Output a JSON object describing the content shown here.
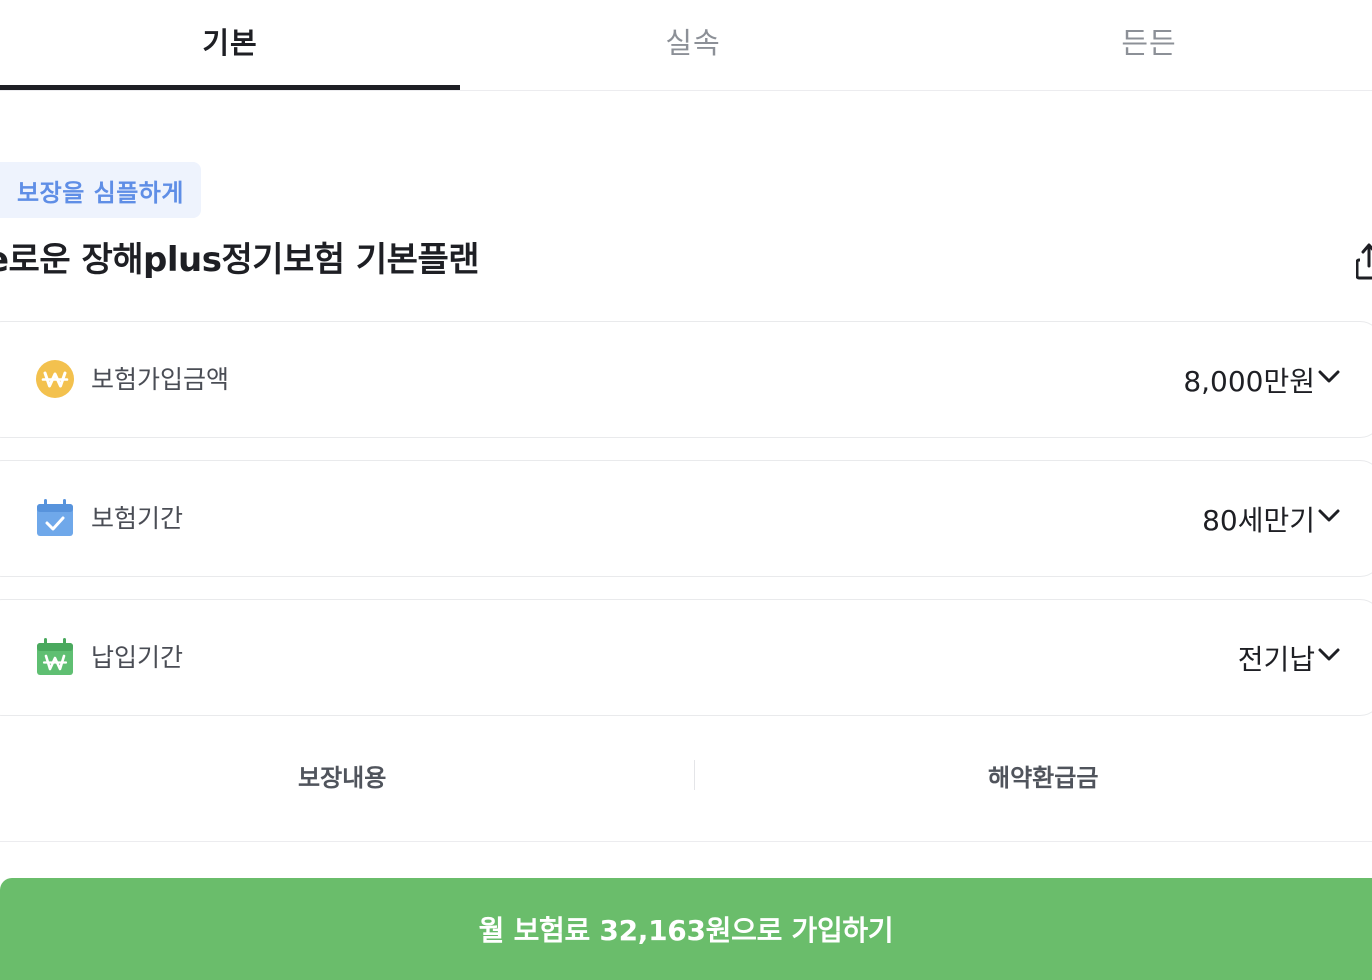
{
  "tabs": [
    {
      "label": "기본",
      "active": true
    },
    {
      "label": "실속",
      "active": false
    },
    {
      "label": "든든",
      "active": false
    }
  ],
  "badge": "보장을 심플하게",
  "plan_title": "e로운 장해plus정기보험 기본플랜",
  "options": [
    {
      "label": "보험가입금액",
      "value": "8,000만원",
      "icon": "won-coin-icon",
      "icon_color": "#f3c14e"
    },
    {
      "label": "보험기간",
      "value": "80세만기",
      "icon": "calendar-check-icon",
      "icon_color": "#6fa8ea"
    },
    {
      "label": "납입기간",
      "value": "전기납",
      "icon": "calendar-won-icon",
      "icon_color": "#5fbf72"
    }
  ],
  "subtabs": [
    "보장내용",
    "해약환급금"
  ],
  "cta": "월 보험료 32,163원으로 가입하기",
  "colors": {
    "accent": "#6abd6b",
    "badge_text": "#5f8ee6",
    "badge_bg": "#eef3fd"
  }
}
